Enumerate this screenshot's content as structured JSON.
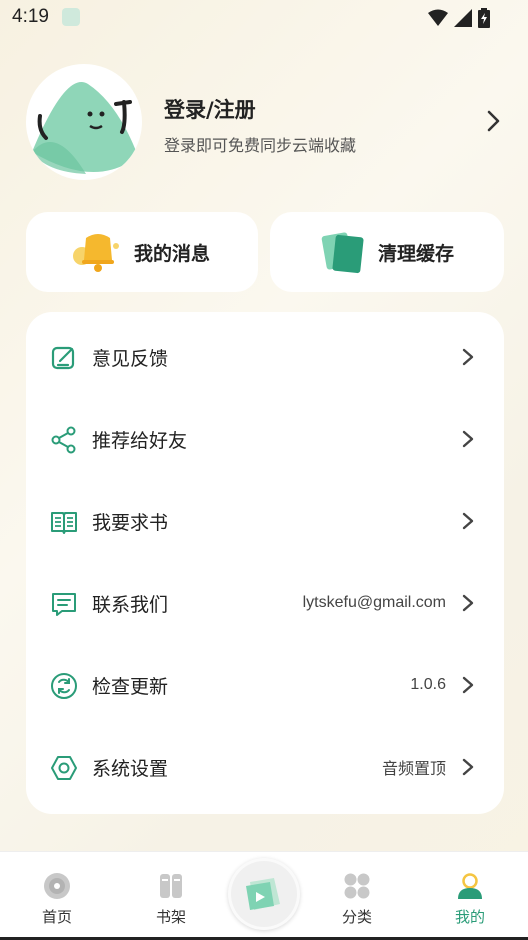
{
  "status": {
    "time": "4:19"
  },
  "profile": {
    "title": "登录/注册",
    "subtitle": "登录即可免费同步云端收藏"
  },
  "quick": {
    "messages": "我的消息",
    "clear_cache": "清理缓存"
  },
  "menu": [
    {
      "label": "意见反馈",
      "value": ""
    },
    {
      "label": "推荐给好友",
      "value": ""
    },
    {
      "label": "我要求书",
      "value": ""
    },
    {
      "label": "联系我们",
      "value": "lytskefu@gmail.com"
    },
    {
      "label": "检查更新",
      "value": "1.0.6"
    },
    {
      "label": "系统设置",
      "value": "音频置顶"
    }
  ],
  "tabs": [
    {
      "label": "首页"
    },
    {
      "label": "书架"
    },
    {
      "label": "分类"
    },
    {
      "label": "我的"
    }
  ],
  "colors": {
    "accent": "#2a9c78",
    "accent_light": "#7fd3b3",
    "yellow": "#f5c542"
  }
}
